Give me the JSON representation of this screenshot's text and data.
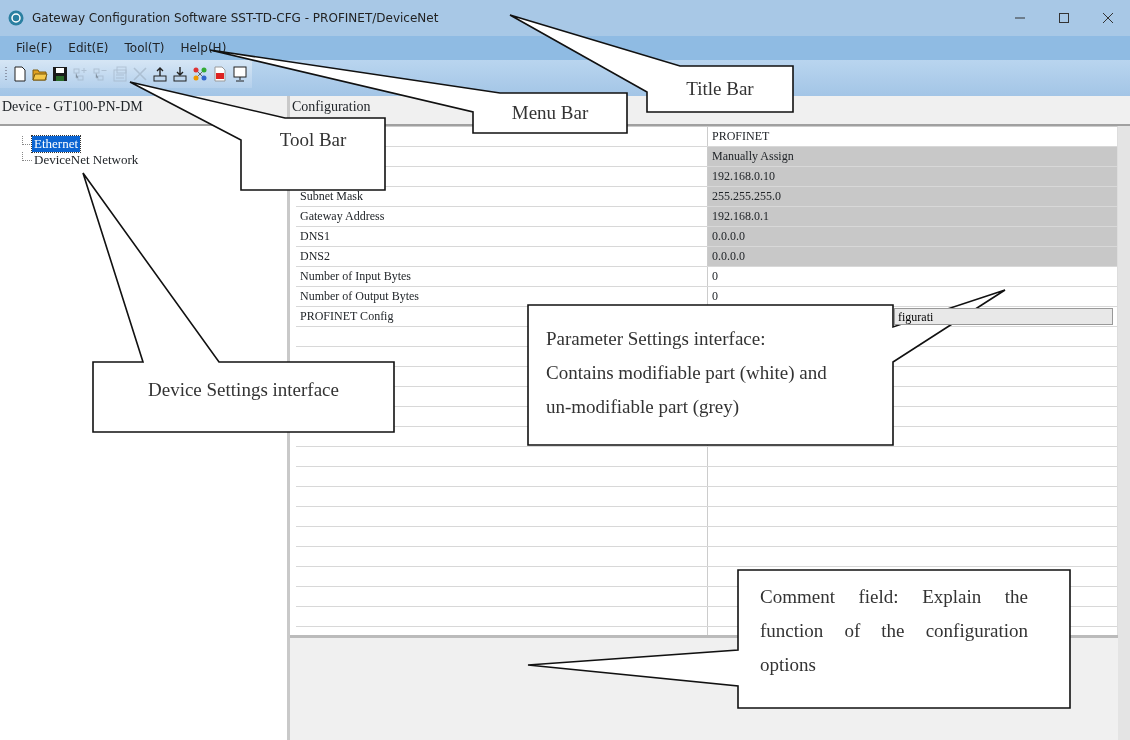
{
  "window": {
    "title": "Gateway Configuration Software SST-TD-CFG - PROFINET/DeviceNet"
  },
  "menu": [
    "File(F)",
    "Edit(E)",
    "Tool(T)",
    "Help(H)"
  ],
  "toolbar": [
    {
      "kind": "new",
      "disabled": false
    },
    {
      "kind": "open",
      "disabled": false
    },
    {
      "kind": "save",
      "disabled": false
    },
    {
      "kind": "add-node",
      "disabled": true
    },
    {
      "kind": "remove-node",
      "disabled": true
    },
    {
      "kind": "properties",
      "disabled": true
    },
    {
      "kind": "delete",
      "disabled": true
    },
    {
      "kind": "upload",
      "disabled": false
    },
    {
      "kind": "download",
      "disabled": false
    },
    {
      "kind": "network",
      "disabled": false
    },
    {
      "kind": "pdf",
      "disabled": false
    },
    {
      "kind": "monitor",
      "disabled": false
    }
  ],
  "device_panel": {
    "title": "Device - GT100-PN-DM",
    "tree": [
      {
        "label": "Ethernet",
        "selected": true
      },
      {
        "label": "DeviceNet Network",
        "selected": false
      }
    ]
  },
  "config_panel": {
    "title": "Configuration",
    "rows": [
      {
        "value": "PROFINET",
        "editable": true,
        "kind": "text"
      },
      {
        "value": "Manually Assign",
        "editable": false,
        "kind": "text"
      },
      {
        "value": "192.168.0.10",
        "editable": false,
        "kind": "text"
      },
      {
        "name": "Subnet Mask",
        "value": "255.255.255.0",
        "editable": false,
        "kind": "text"
      },
      {
        "name": "Gateway Address",
        "value": "192.168.0.1",
        "editable": false,
        "kind": "text"
      },
      {
        "name": "DNS1",
        "value": "0.0.0.0",
        "editable": false,
        "kind": "text"
      },
      {
        "name": "DNS2",
        "value": "0.0.0.0",
        "editable": false,
        "kind": "text"
      },
      {
        "name": "Number of Input Bytes",
        "value": "0",
        "editable": true,
        "kind": "text"
      },
      {
        "name": "Number of Output Bytes",
        "value": "0",
        "editable": true,
        "kind": "text"
      },
      {
        "name": "PROFINET Config",
        "value": "figurati",
        "kind": "button"
      }
    ]
  },
  "callouts": [
    {
      "kind": "title",
      "text": "Title Bar"
    },
    {
      "kind": "menu",
      "text": "Menu Bar"
    },
    {
      "kind": "tool",
      "text": "Tool Bar"
    },
    {
      "kind": "device",
      "text": "Device Settings interface"
    },
    {
      "kind": "param",
      "text": "Parameter Settings interface: Contains modifiable part (white) and un-modifiable part (grey)"
    },
    {
      "kind": "comment",
      "text": "Comment field: Explain the function of the configuration options"
    }
  ]
}
